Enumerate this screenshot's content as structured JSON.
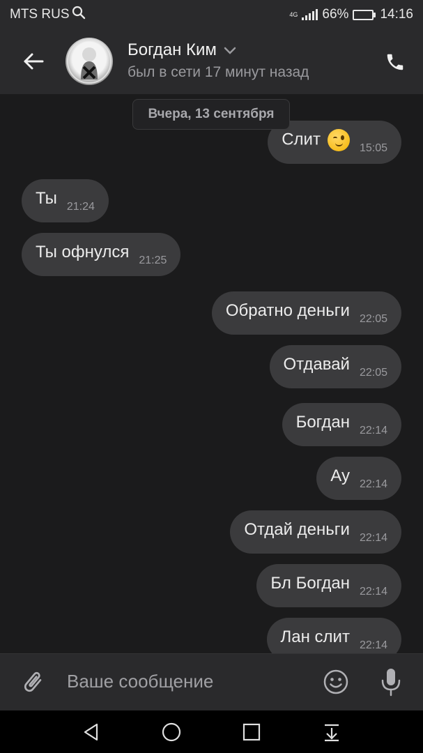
{
  "status_bar": {
    "carrier": "MTS RUS",
    "network": "4G",
    "battery_percent": "66%",
    "battery_level": 0.66,
    "time": "14:16"
  },
  "header": {
    "name": "Богдан Ким",
    "status": "был в сети 17 минут назад"
  },
  "chat": {
    "date_separator": "Вчера, 13 сентября",
    "messages": [
      {
        "text": "Слит",
        "time": "15:05",
        "outgoing": true,
        "emoji": "winking-face"
      },
      {
        "text": "Ты",
        "time": "21:24",
        "outgoing": false
      },
      {
        "text": "Ты офнулся",
        "time": "21:25",
        "outgoing": false
      },
      {
        "text": "Обратно деньги",
        "time": "22:05",
        "outgoing": true
      },
      {
        "text": "Отдавай",
        "time": "22:05",
        "outgoing": true
      },
      {
        "text": "Богдан",
        "time": "22:14",
        "outgoing": true
      },
      {
        "text": "Ау",
        "time": "22:14",
        "outgoing": true
      },
      {
        "text": "Отдай деньги",
        "time": "22:14",
        "outgoing": true
      },
      {
        "text": "Бл Богдан",
        "time": "22:14",
        "outgoing": true
      },
      {
        "text": "Лан слит",
        "time": "22:14",
        "outgoing": true
      }
    ]
  },
  "composer": {
    "placeholder": "Ваше сообщение"
  },
  "icons": {
    "back": "arrow-left-icon",
    "call": "phone-icon",
    "search": "search-icon",
    "attach": "paperclip-icon",
    "emoji": "smiley-icon",
    "mic": "microphone-icon",
    "nav_back": "triangle-back-icon",
    "nav_home": "circle-home-icon",
    "nav_recent": "square-recent-icon",
    "nav_notifications": "pull-down-icon"
  },
  "colors": {
    "background": "#1b1b1c",
    "bar": "#2a2a2c",
    "bubble": "#3b3b3d",
    "battery": "#3ec846"
  }
}
